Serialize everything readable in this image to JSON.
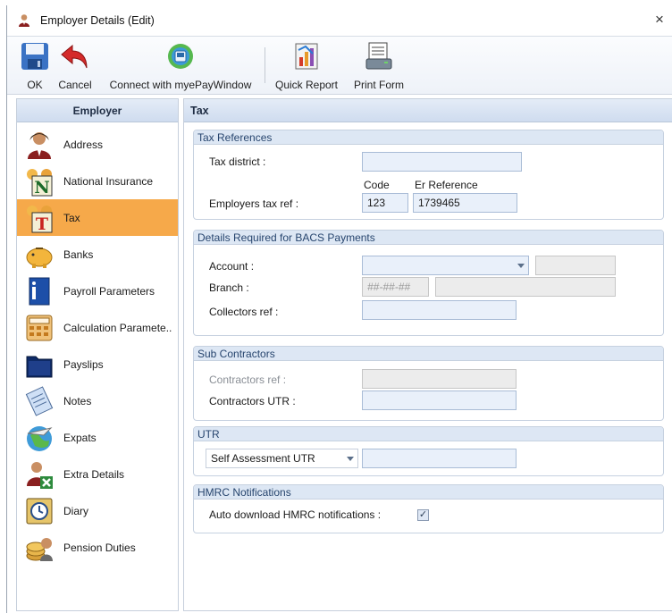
{
  "window": {
    "title": "Employer Details (Edit)",
    "close_symbol": "×"
  },
  "toolbar": {
    "ok": "OK",
    "cancel": "Cancel",
    "connect": "Connect with myePayWindow",
    "quick_report": "Quick Report",
    "print_form": "Print Form"
  },
  "nav": {
    "header": "Employer",
    "items": [
      {
        "label": "Address",
        "icon": "person-icon"
      },
      {
        "label": "National Insurance",
        "icon": "national-insurance-icon"
      },
      {
        "label": "Tax",
        "icon": "tax-icon",
        "active": true
      },
      {
        "label": "Banks",
        "icon": "piggy-bank-icon"
      },
      {
        "label": "Payroll Parameters",
        "icon": "binder-icon"
      },
      {
        "label": "Calculation Paramete..",
        "icon": "calculator-icon"
      },
      {
        "label": "Payslips",
        "icon": "payslip-folder-icon"
      },
      {
        "label": "Notes",
        "icon": "notepad-icon"
      },
      {
        "label": "Expats",
        "icon": "globe-plane-icon"
      },
      {
        "label": "Extra Details",
        "icon": "person-extra-icon"
      },
      {
        "label": "Diary",
        "icon": "clock-diary-icon"
      },
      {
        "label": "Pension Duties",
        "icon": "pension-coins-icon"
      }
    ]
  },
  "main": {
    "header": "Tax",
    "tax_references": {
      "title": "Tax References",
      "tax_district_label": "Tax district :",
      "tax_district_value": "",
      "code_header": "Code",
      "er_reference_header": "Er Reference",
      "employers_tax_ref_label": "Employers tax ref :",
      "code_value": "123",
      "er_reference_value": "1739465"
    },
    "bacs": {
      "title": "Details Required for BACS Payments",
      "account_label": "Account :",
      "account_value": "",
      "branch_label": "Branch :",
      "branch_placeholder": "##-##-##",
      "collectors_ref_label": "Collectors ref :",
      "collectors_ref_value": ""
    },
    "sub_contractors": {
      "title": "Sub Contractors",
      "contractors_ref_label": "Contractors ref :",
      "contractors_utr_label": "Contractors UTR :"
    },
    "utr": {
      "title": "UTR",
      "type_selected": "Self Assessment UTR",
      "value": ""
    },
    "hmrc": {
      "title": "HMRC Notifications",
      "auto_download_label": "Auto download HMRC notifications :",
      "auto_download_checked": true,
      "check_symbol": "✓"
    }
  }
}
